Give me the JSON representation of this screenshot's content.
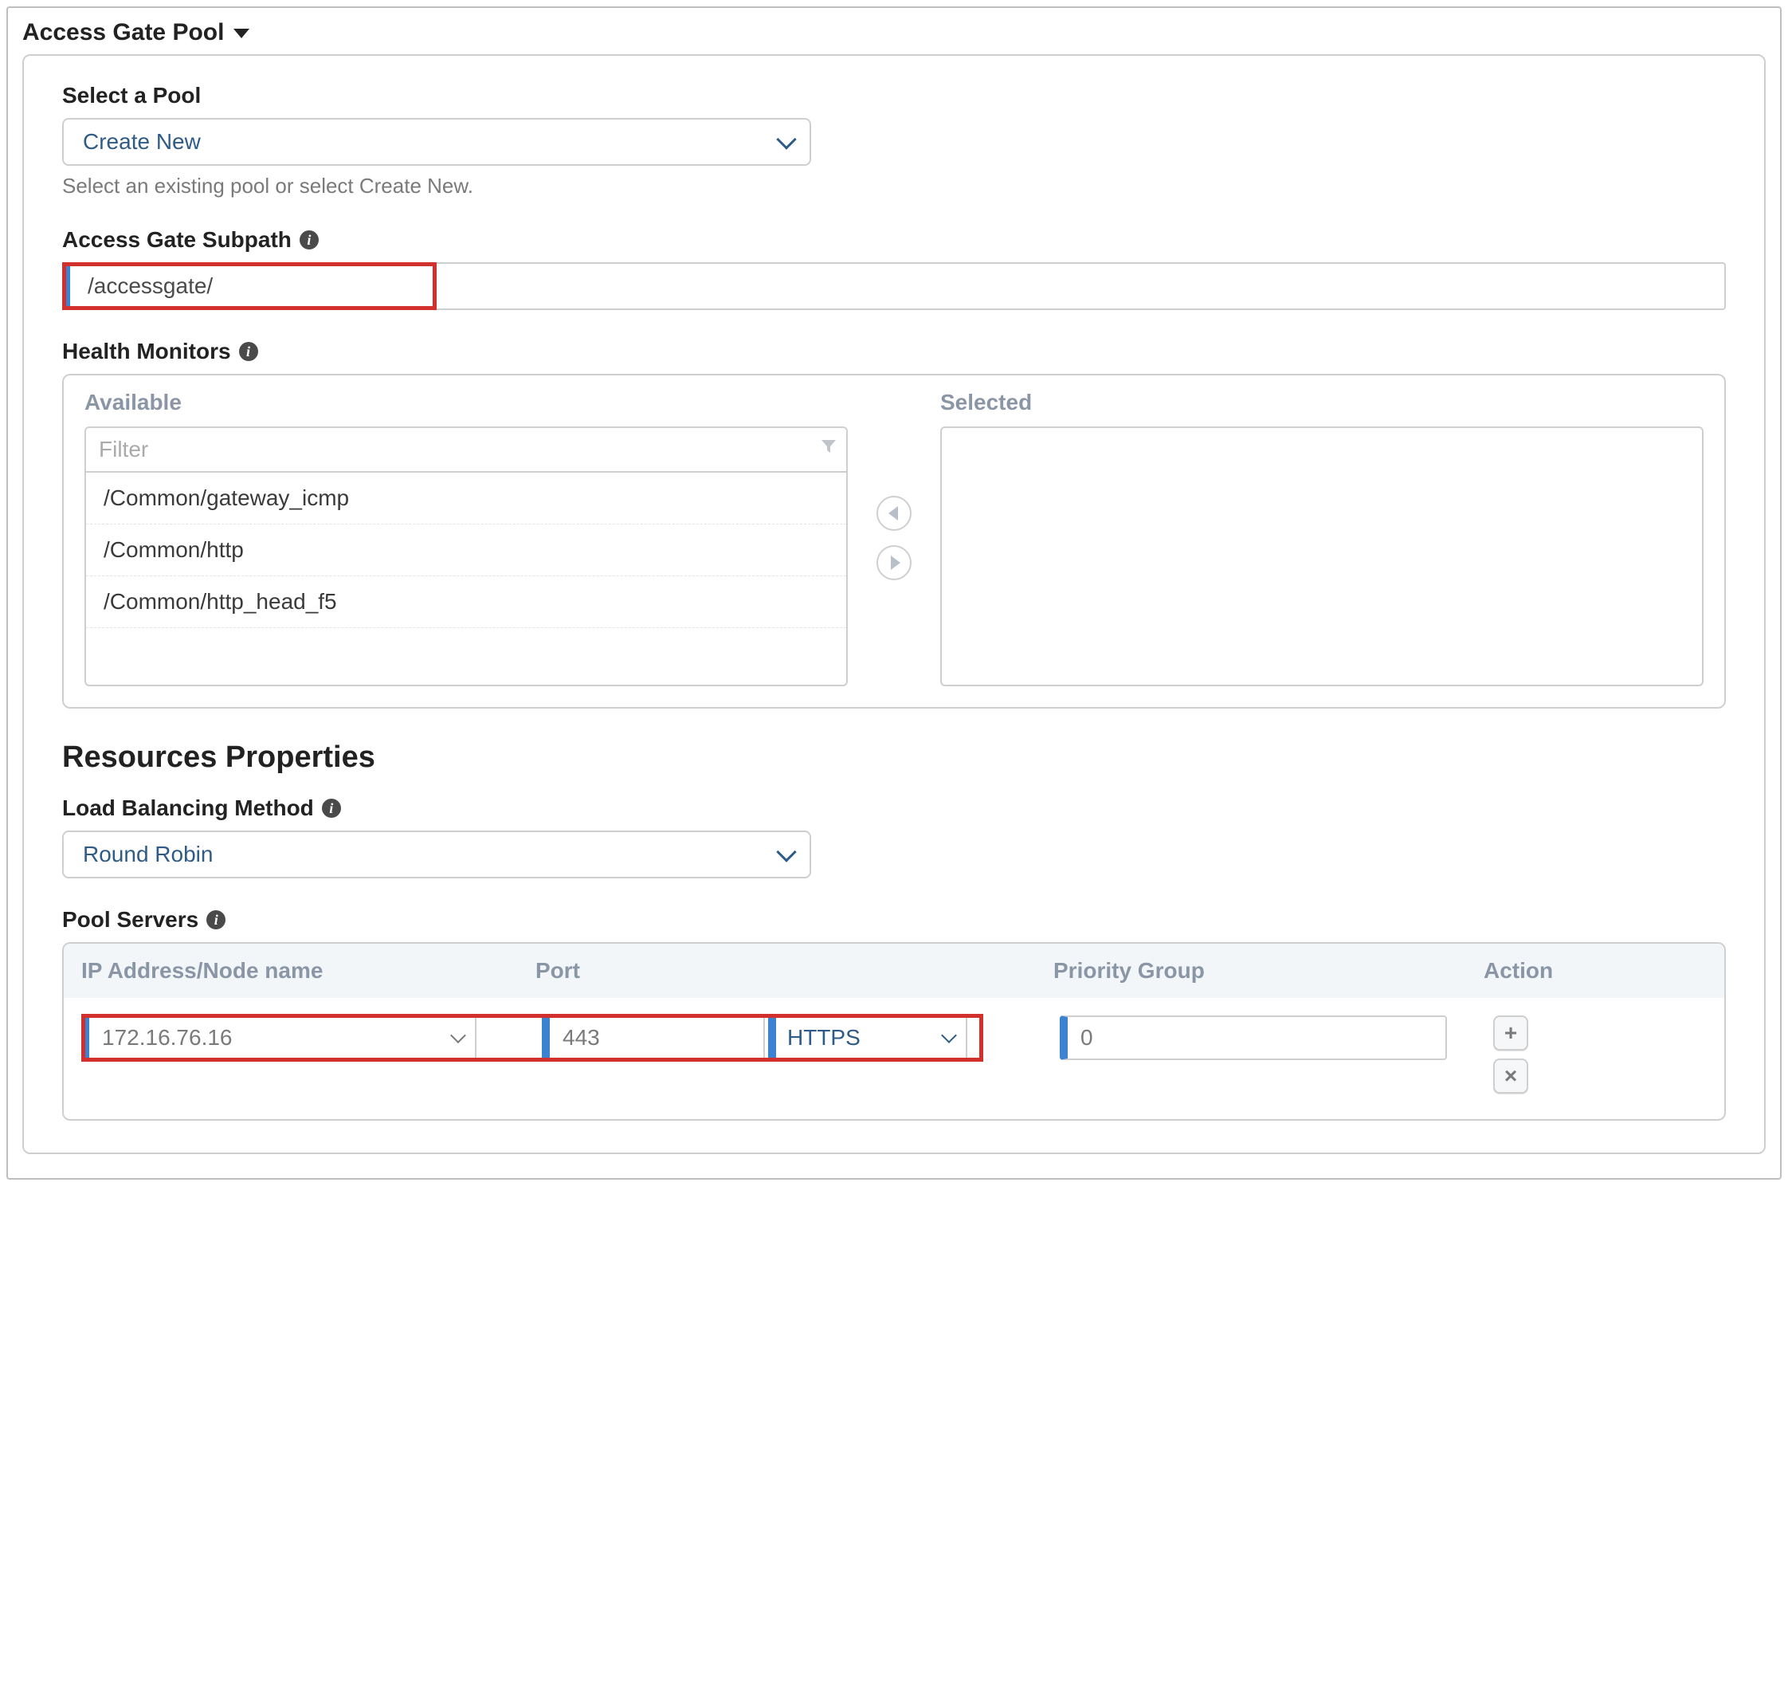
{
  "section": {
    "title": "Access Gate Pool"
  },
  "pool": {
    "label": "Select a Pool",
    "value": "Create New",
    "helper": "Select an existing pool or select Create New."
  },
  "subpath": {
    "label": "Access Gate Subpath",
    "value": "/accessgate/"
  },
  "health": {
    "label": "Health Monitors",
    "available_label": "Available",
    "selected_label": "Selected",
    "filter_placeholder": "Filter",
    "items": [
      "/Common/gateway_icmp",
      "/Common/http",
      "/Common/http_head_f5"
    ]
  },
  "resources": {
    "heading": "Resources Properties"
  },
  "lb": {
    "label": "Load Balancing Method",
    "value": "Round Robin"
  },
  "servers": {
    "label": "Pool Servers",
    "cols": {
      "ip": "IP Address/Node name",
      "port": "Port",
      "pg": "Priority Group",
      "action": "Action"
    },
    "rows": [
      {
        "ip": "172.16.76.16",
        "port": "443",
        "proto": "HTTPS",
        "pg": "0"
      }
    ],
    "action_add": "+",
    "action_remove": "×"
  }
}
